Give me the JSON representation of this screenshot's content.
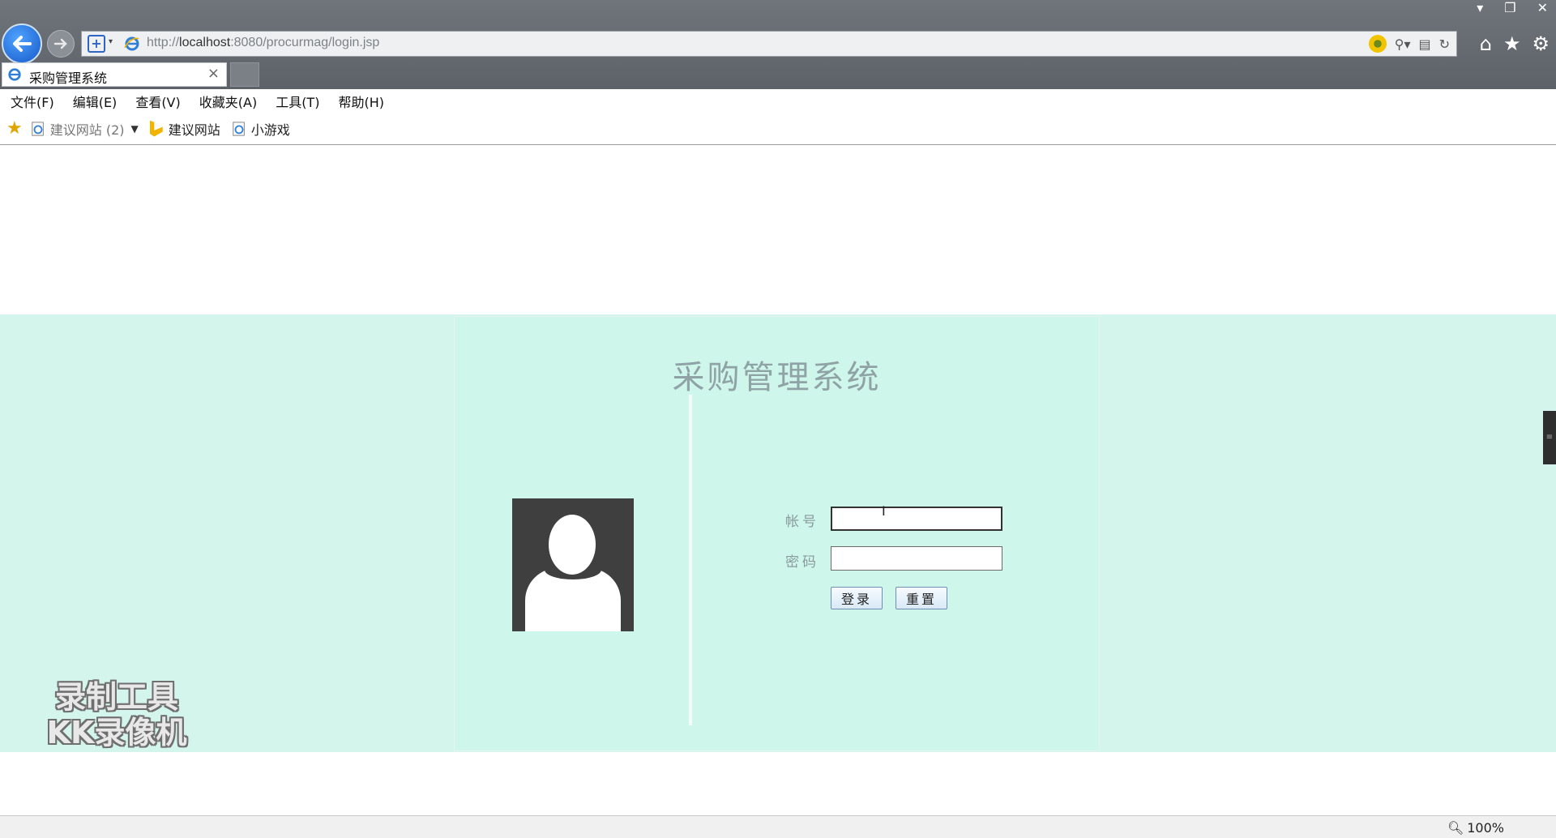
{
  "browser": {
    "url_prefix": "http://",
    "url_host": "localhost",
    "url_rest": ":8080/procurmag/login.jsp",
    "tab_title": "采购管理系统",
    "tab_close": "×",
    "menu": [
      "文件(F)",
      "编辑(E)",
      "查看(V)",
      "收藏夹(A)",
      "工具(T)",
      "帮助(H)"
    ],
    "favorites": {
      "suggested_sites_dropdown": "建议网站 (2)",
      "suggested_sites": "建议网站",
      "games": "小游戏"
    },
    "zoom": "100%"
  },
  "page": {
    "system_title": "采购管理系统",
    "account_label": "帐号",
    "password_label": "密码",
    "account_value": "",
    "password_value": "",
    "login_button": "登录",
    "reset_button": "重置"
  },
  "watermark": {
    "line1": "录制工具",
    "line2": "KK录像机"
  },
  "colors": {
    "band": "#d3f5ec",
    "panel": "#cff6ea",
    "title": "#8fa3a6",
    "avatar_bg": "#3f3f3f"
  }
}
